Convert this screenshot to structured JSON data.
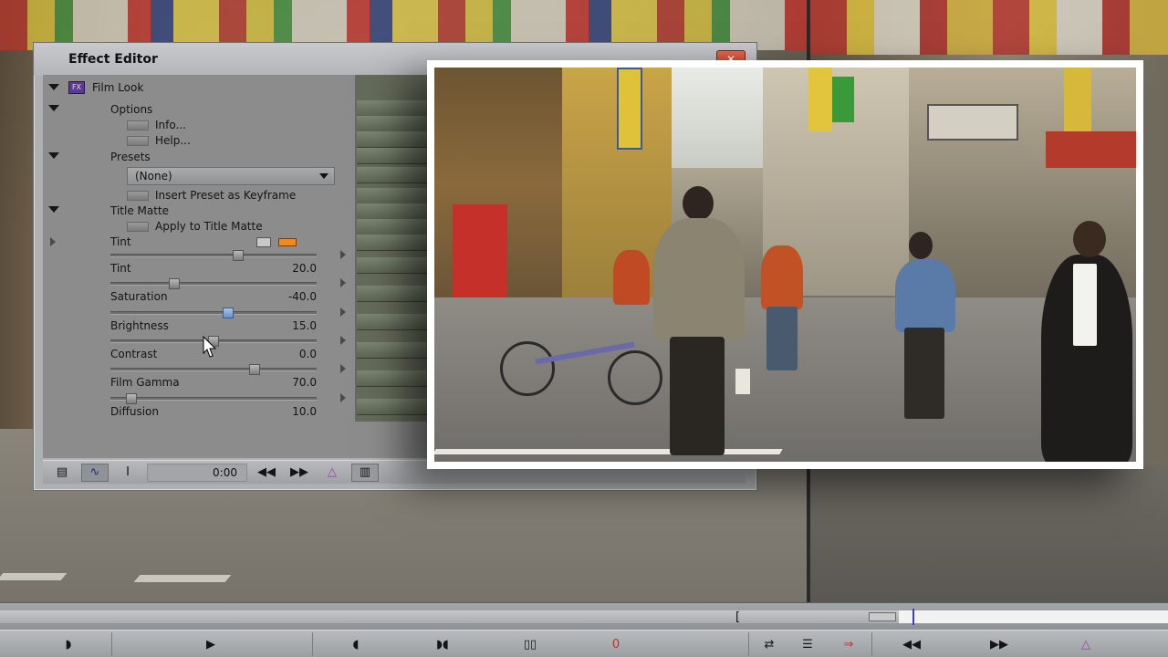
{
  "effect_editor": {
    "title": "Effect Editor",
    "close_glyph": "✕",
    "effect_name": "Film Look",
    "effect_icon": "fx-film-icon",
    "sections": {
      "options": "Options",
      "info": "Info...",
      "help": "Help...",
      "presets": "Presets",
      "preset_value": "(None)",
      "insert_preset": "Insert Preset as Keyframe",
      "title_matte": "Title Matte",
      "apply_title_matte": "Apply to Title Matte",
      "tint_color": "Tint"
    },
    "parameters": [
      {
        "label": "Tint",
        "value": "20.0",
        "slider_fraction": 0.62
      },
      {
        "label": "Saturation",
        "value": "-40.0",
        "slider_fraction": 0.31
      },
      {
        "label": "Brightness",
        "value": "15.0",
        "slider_fraction": 0.57
      },
      {
        "label": "Contrast",
        "value": "0.0",
        "slider_fraction": 0.5
      },
      {
        "label": "Film Gamma",
        "value": "70.0",
        "slider_fraction": 0.7
      },
      {
        "label": "Diffusion",
        "value": "10.0",
        "slider_fraction": 0.1
      }
    ],
    "tint_swatch_color": "#f08a1c",
    "toolbar": {
      "timecode": "0:00"
    }
  },
  "timeline": {
    "bracket": "["
  },
  "colors": {
    "selected_thumb": "#6a8fc6",
    "keyframe_marker": "#a23bb5"
  }
}
